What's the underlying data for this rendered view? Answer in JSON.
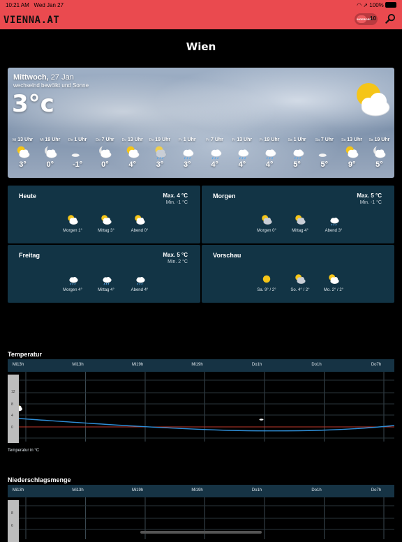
{
  "status": {
    "time": "10:21 AM",
    "date": "Wed Jan 27",
    "battery": "100%"
  },
  "nav": {
    "logo": "VIENNA.AT",
    "pill_badge": "INGEBORG",
    "notification_count": "10"
  },
  "page_title": "Wien",
  "hero": {
    "weekday": "Mittwoch,",
    "date": "27 Jan",
    "condition": "wechselnd bewölkt und Sonne",
    "temperature": "3°c",
    "icon": "partly-cloudy-sun-icon"
  },
  "hourly": [
    {
      "day": "Mi",
      "time": "13 Uhr",
      "temp": "3°",
      "icon": "sun-cloud"
    },
    {
      "day": "Mi",
      "time": "19 Uhr",
      "temp": "0°",
      "icon": "moon-cloud"
    },
    {
      "day": "Do",
      "time": "1 Uhr",
      "temp": "-1°",
      "icon": "moon-clear"
    },
    {
      "day": "Do",
      "time": "7 Uhr",
      "temp": "0°",
      "icon": "moon-cloud"
    },
    {
      "day": "Do",
      "time": "13 Uhr",
      "temp": "4°",
      "icon": "sun-cloud"
    },
    {
      "day": "Do",
      "time": "19 Uhr",
      "temp": "3°",
      "icon": "moon-rain"
    },
    {
      "day": "Fr",
      "time": "1 Uhr",
      "temp": "3°",
      "icon": "rain"
    },
    {
      "day": "Fr",
      "time": "7 Uhr",
      "temp": "4°",
      "icon": "rain"
    },
    {
      "day": "Fr",
      "time": "13 Uhr",
      "temp": "4°",
      "icon": "rain"
    },
    {
      "day": "Fr",
      "time": "19 Uhr",
      "temp": "4°",
      "icon": "rain"
    },
    {
      "day": "Sa",
      "time": "1 Uhr",
      "temp": "5°",
      "icon": "rain"
    },
    {
      "day": "Sa",
      "time": "7 Uhr",
      "temp": "5°",
      "icon": "moon-clear"
    },
    {
      "day": "Sa",
      "time": "13 Uhr",
      "temp": "9°",
      "icon": "sun-cloud"
    },
    {
      "day": "Sa",
      "time": "19 Uhr",
      "temp": "5°",
      "icon": "moon-cloud"
    }
  ],
  "cards": [
    {
      "title": "Heute",
      "max": "Max. 4 °C",
      "min": "Min. -1 °C",
      "parts": [
        {
          "label": "Morgen 1°",
          "icon": "sun-cloud"
        },
        {
          "label": "Mittag 3°",
          "icon": "sun-cloud"
        },
        {
          "label": "Abend 0°",
          "icon": "sun-cloud"
        }
      ]
    },
    {
      "title": "Morgen",
      "max": "Max. 5 °C",
      "min": "Min. -1 °C",
      "parts": [
        {
          "label": "Morgen 0°",
          "icon": "sun-cloud-dark"
        },
        {
          "label": "Mittag 4°",
          "icon": "sun-cloud-dark"
        },
        {
          "label": "Abend 3°",
          "icon": "rain"
        }
      ]
    },
    {
      "title": "Freitag",
      "max": "Max. 5 °C",
      "min": "Min. 2 °C",
      "parts": [
        {
          "label": "Morgen 4°",
          "icon": "rain"
        },
        {
          "label": "Mittag 4°",
          "icon": "rain"
        },
        {
          "label": "Abend 4°",
          "icon": "rain"
        }
      ]
    },
    {
      "title": "Vorschau",
      "max": "",
      "min": "",
      "parts": [
        {
          "label": "Sa. 9° / 2°",
          "icon": "sun"
        },
        {
          "label": "So. 4° / 2°",
          "icon": "sun-cloud-dark"
        },
        {
          "label": "Mo. 2° / 2°",
          "icon": "sun-cloud"
        }
      ]
    }
  ],
  "temp_chart": {
    "title": "Temperatur",
    "header_labels": [
      "Mi13h",
      "Mi13h",
      "Mi19h",
      "Mi19h",
      "Do1h",
      "Do1h",
      "Do7h"
    ],
    "y_ticks": [
      "12",
      "8",
      "4",
      "0"
    ],
    "note": "Temperatur in °C"
  },
  "precip_chart": {
    "title": "Niederschlagsmenge",
    "header_labels": [
      "Mi13h",
      "Mi13h",
      "Mi19h",
      "Mi19h",
      "Do1h",
      "Do1h",
      "Do7h"
    ],
    "y_ticks": [
      "8",
      "6"
    ]
  },
  "colors": {
    "brand": "#ea4a4f",
    "card": "#123445",
    "temp_line": "#2f8fd8",
    "zero_line": "#c0392b"
  }
}
